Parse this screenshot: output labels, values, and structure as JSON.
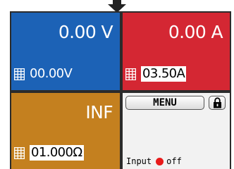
{
  "voltage": {
    "actual": "0.00 V",
    "set": "00.00V",
    "color": "#1c62b6",
    "icon": "grid-icon"
  },
  "current": {
    "actual": "0.00 A",
    "set": "03.50A",
    "color": "#d42733",
    "icon": "grid-icon"
  },
  "resistance": {
    "actual": "INF",
    "set": "01.000Ω",
    "color": "#c4801f",
    "icon": "grid-icon"
  },
  "status": {
    "menu_label": "MENU",
    "lock_icon": "lock-icon",
    "input_label": "Input",
    "input_state": "off",
    "indicator_color": "#e81a1a"
  },
  "top_indicator": {
    "icon": "arrow-down-icon"
  }
}
